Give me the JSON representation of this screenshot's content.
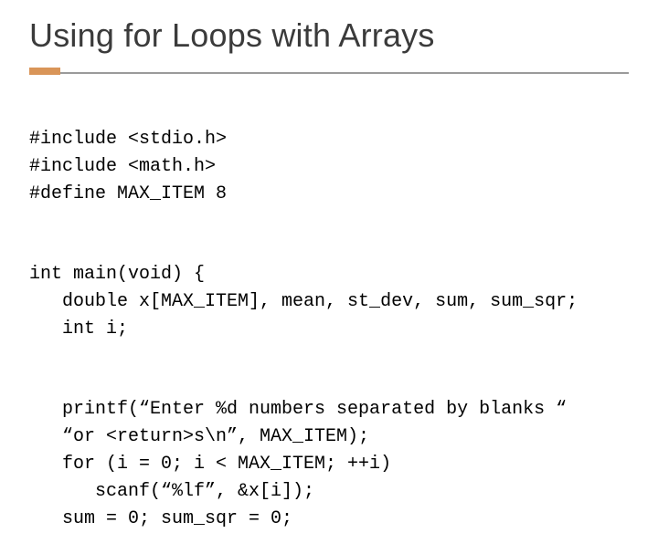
{
  "title": "Using for Loops with Arrays",
  "code": {
    "l1": "#include <stdio.h>",
    "l2": "#include <math.h>",
    "l3": "#define MAX_ITEM 8",
    "l4": "int main(void) {",
    "l5": "   double x[MAX_ITEM], mean, st_dev, sum, sum_sqr;",
    "l6": "   int i;",
    "l7": "   printf(“Enter %d numbers separated by blanks “",
    "l8": "   “or <return>s\\n”, MAX_ITEM);",
    "l9": "   for (i = 0; i < MAX_ITEM; ++i)",
    "l10": "      scanf(“%lf”, &x[i]);",
    "l11": "   sum = 0; sum_sqr = 0;"
  }
}
